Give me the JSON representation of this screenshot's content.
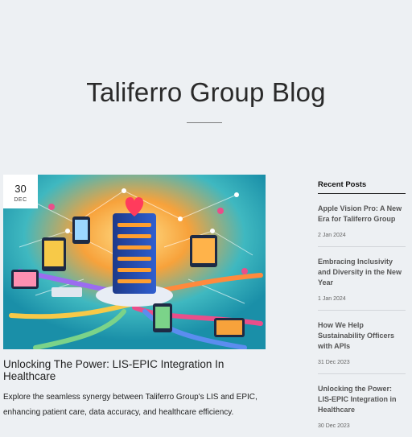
{
  "header": {
    "blog_title": "Taliferro Group Blog"
  },
  "featured_post": {
    "date_day": "30",
    "date_month": "DEC",
    "title": "Unlocking The Power: LIS-EPIC Integration In Healthcare",
    "excerpt": "Explore the seamless synergy between Taliferro Group's LIS and EPIC, enhancing patient care, data accuracy, and healthcare efficiency."
  },
  "sidebar": {
    "heading": "Recent Posts",
    "posts": [
      {
        "title": "Apple Vision Pro: A New Era for Taliferro Group",
        "date": "2 Jan 2024"
      },
      {
        "title": "Embracing Inclusivity and Diversity in the New Year",
        "date": "1 Jan 2024"
      },
      {
        "title": "How We Help Sustainability Officers with APIs",
        "date": "31 Dec 2023"
      },
      {
        "title": "Unlocking the Power: LIS-EPIC Integration in Healthcare",
        "date": "30 Dec 2023"
      }
    ]
  },
  "colors": {
    "background": "#edf0f3",
    "image_teal": "#1a9aa8",
    "image_orange": "#f7a23b"
  }
}
